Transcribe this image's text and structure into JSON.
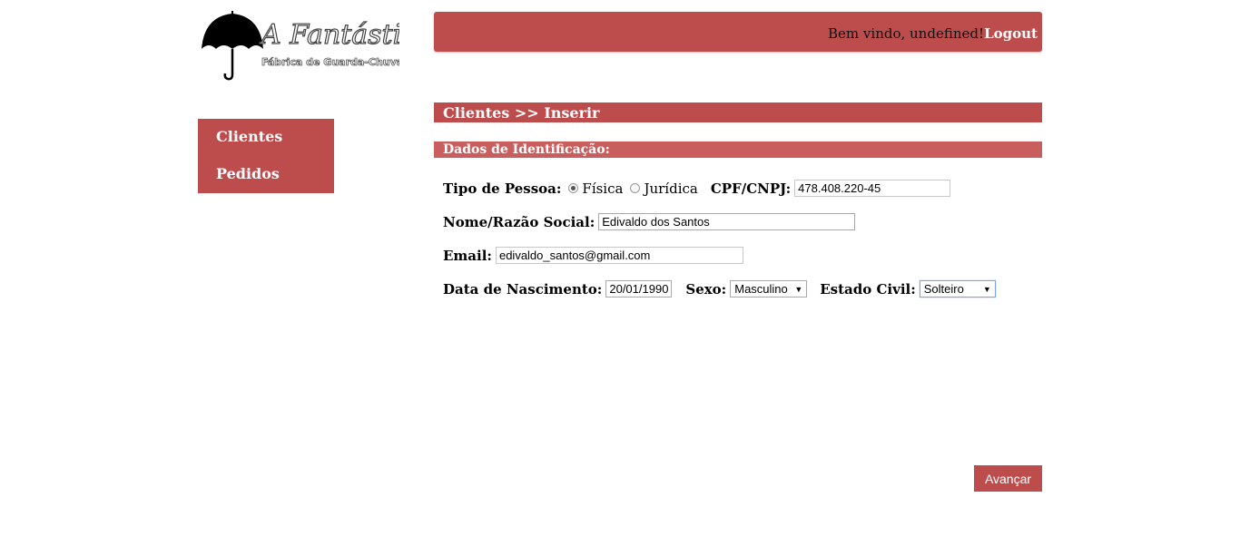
{
  "header": {
    "logo_title": "A Fantástica",
    "logo_subtitle": "Fábrica de Guarda-Chuvas",
    "welcome": "Bem vindo, undefined!",
    "logout": "Logout",
    "accent_color": "#bd4c4d"
  },
  "sidebar": {
    "items": [
      {
        "label": "Clientes"
      },
      {
        "label": "Pedidos"
      }
    ]
  },
  "page": {
    "title": "Clientes >> Inserir",
    "section": "Dados de Identificação:"
  },
  "form": {
    "tipo_label": "Tipo de Pessoa:",
    "fisica": "Física",
    "juridica": "Jurídica",
    "selected_tipo": "Física",
    "cpf_label": "CPF/CNPJ:",
    "cpf_value": "478.408.220-45",
    "nome_label": "Nome/Razão Social:",
    "nome_value": "Edivaldo dos Santos",
    "email_label": "Email:",
    "email_value": "edivaldo_santos@gmail.com",
    "nasc_label": "Data de Nascimento:",
    "nasc_value": "20/01/1990",
    "sexo_label": "Sexo:",
    "sexo_value": "Masculino",
    "estado_label": "Estado Civil:",
    "estado_value": "Solteiro"
  },
  "actions": {
    "avancar": "Avançar"
  }
}
